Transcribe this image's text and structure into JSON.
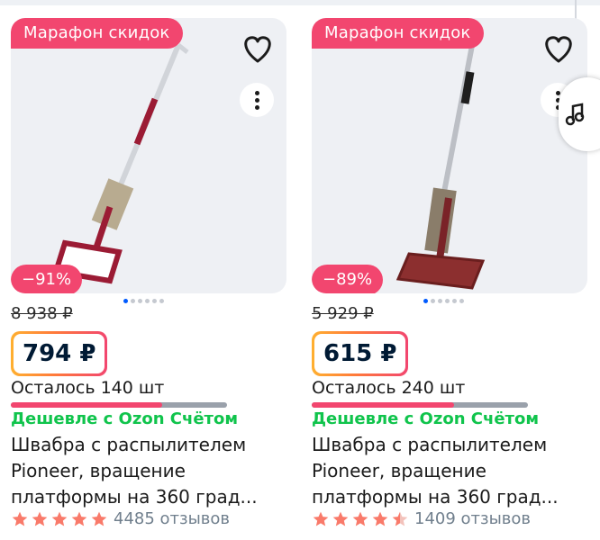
{
  "products": [
    {
      "promo_label": "Марафон скидок",
      "discount": "−91%",
      "old_price": "8 938 ₽",
      "price": "794 ₽",
      "stock": "Осталось 140 шт",
      "stock_fraction": 0.7,
      "cheaper": "Дешевле с Ozon Счётом",
      "title_lines": [
        "Швабра с распылителем",
        "Pioneer, вращение",
        "платформы на 360 град..."
      ],
      "rating_stars": 5,
      "reviews": "4485 отзывов",
      "mop_handle_color": "#c8cbd0",
      "mop_head_color": "#9b1b34"
    },
    {
      "promo_label": "Марафон скидок",
      "discount": "−89%",
      "old_price": "5 929 ₽",
      "price": "615 ₽",
      "stock": "Осталось 240 шт",
      "stock_fraction": 0.66,
      "cheaper": "Дешевле с Ozon Счётом",
      "title_lines": [
        "Швабра с распылителем",
        "Pioneer, вращение",
        "платформы на 360 град..."
      ],
      "rating_stars": 4.5,
      "reviews": "1409 отзывов",
      "mop_handle_color": "#b9bcc2",
      "mop_head_color": "#7a2328"
    }
  ],
  "colors": {
    "promo_pink": "#f2466f",
    "green": "#10c44c",
    "star": "#f97a6a",
    "accent_blue": "#005bff"
  },
  "icons": [
    "heart-icon",
    "more-vert-icon",
    "star-icon",
    "music-note-icon"
  ]
}
